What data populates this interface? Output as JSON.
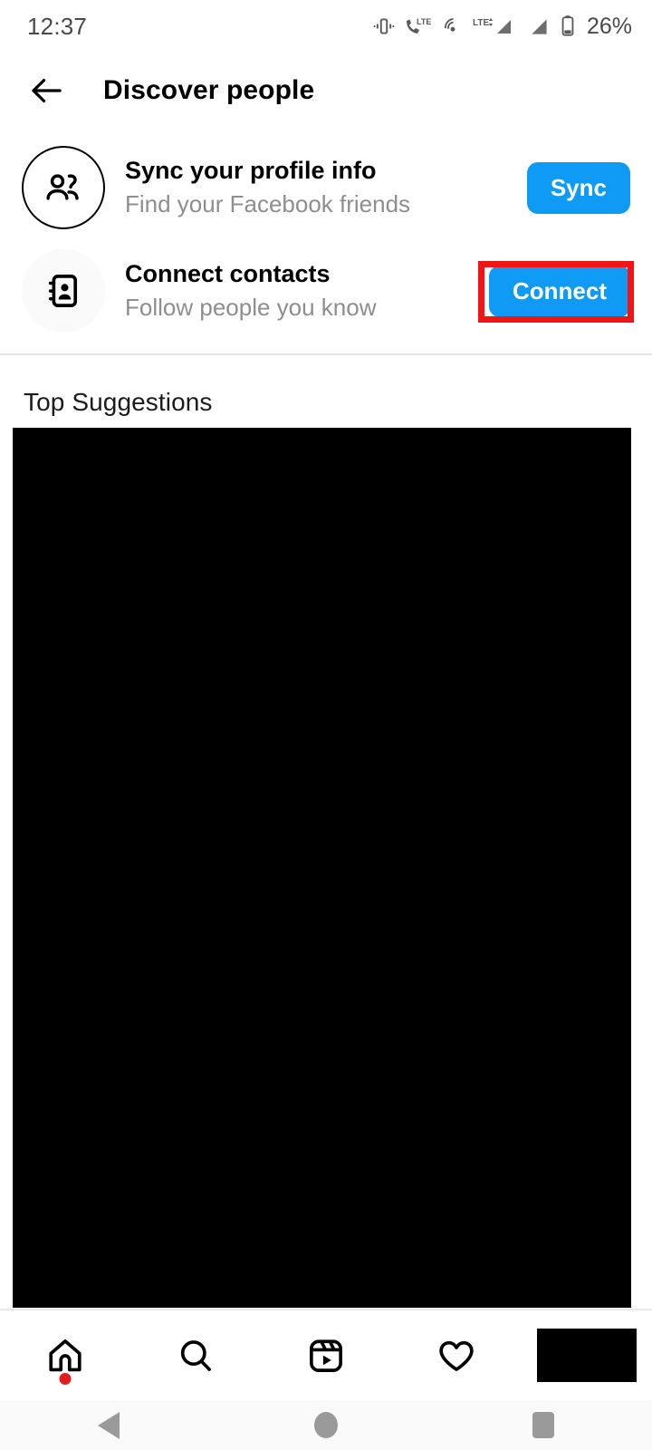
{
  "status_bar": {
    "time": "12:37",
    "battery_percent": "26%",
    "icons": [
      "vibrate-icon",
      "volte-call-icon",
      "hotspot-icon",
      "lte-signal-icon",
      "signal-icon",
      "battery-icon"
    ]
  },
  "header": {
    "back_icon": "back-arrow-icon",
    "title": "Discover people"
  },
  "rows": [
    {
      "icon": "people-icon",
      "title": "Sync your profile info",
      "subtitle": "Find your Facebook friends",
      "button_label": "Sync",
      "highlighted": false
    },
    {
      "icon": "contact-book-icon",
      "title": "Connect contacts",
      "subtitle": "Follow people you know",
      "button_label": "Connect",
      "highlighted": true
    }
  ],
  "suggestions": {
    "section_title": "Top Suggestions"
  },
  "tab_bar": {
    "items": [
      {
        "name": "home",
        "icon": "home-icon",
        "badge": true
      },
      {
        "name": "search",
        "icon": "search-icon",
        "badge": false
      },
      {
        "name": "reels",
        "icon": "reels-icon",
        "badge": false
      },
      {
        "name": "activity",
        "icon": "heart-icon",
        "badge": false
      },
      {
        "name": "profile",
        "icon": "avatar-icon",
        "badge": false
      }
    ]
  },
  "system_nav": {
    "back": "system-back-icon",
    "home": "system-home-icon",
    "recents": "system-recents-icon"
  },
  "colors": {
    "accent_blue": "#0f9bf5",
    "annotation_red": "#f41414",
    "subtitle_gray": "#8e8e8e",
    "badge_red": "#e21b1b"
  }
}
